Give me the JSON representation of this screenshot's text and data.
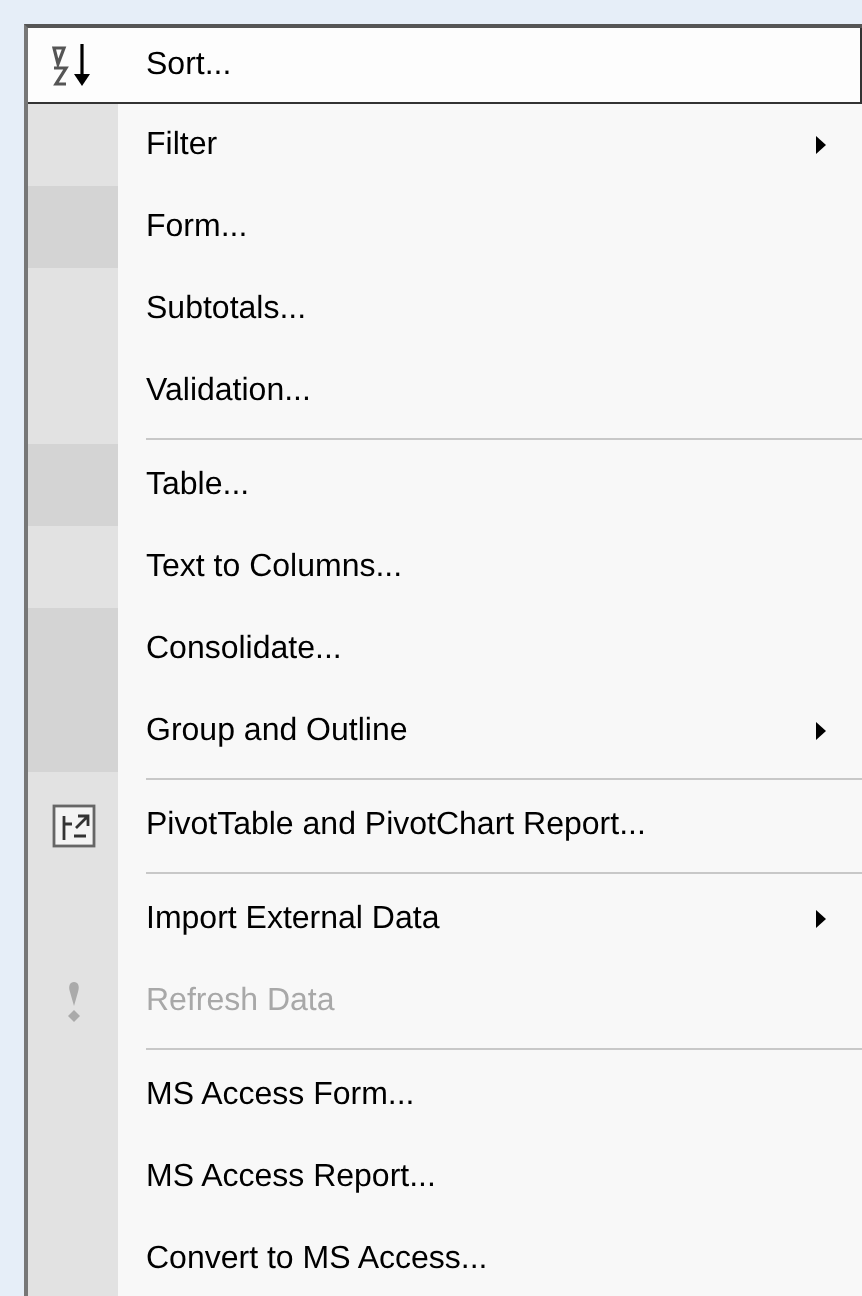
{
  "menu": {
    "items": [
      {
        "kind": "sort",
        "label": "Sort...",
        "selected": true,
        "submenu": false,
        "disabled": false,
        "recent": true
      },
      {
        "kind": "plain",
        "label": "Filter",
        "selected": false,
        "submenu": true,
        "disabled": false,
        "recent": true
      },
      {
        "kind": "plain",
        "label": "Form...",
        "selected": false,
        "submenu": false,
        "disabled": false,
        "recent": false
      },
      {
        "kind": "plain",
        "label": "Subtotals...",
        "selected": false,
        "submenu": false,
        "disabled": false,
        "recent": true
      },
      {
        "kind": "plain",
        "label": "Validation...",
        "selected": false,
        "submenu": false,
        "disabled": false,
        "recent": true
      },
      {
        "kind": "separator"
      },
      {
        "kind": "plain",
        "label": "Table...",
        "selected": false,
        "submenu": false,
        "disabled": false,
        "recent": false
      },
      {
        "kind": "plain",
        "label": "Text to Columns...",
        "selected": false,
        "submenu": false,
        "disabled": false,
        "recent": true
      },
      {
        "kind": "plain",
        "label": "Consolidate...",
        "selected": false,
        "submenu": false,
        "disabled": false,
        "recent": false
      },
      {
        "kind": "plain",
        "label": "Group and Outline",
        "selected": false,
        "submenu": true,
        "disabled": false,
        "recent": false
      },
      {
        "kind": "separator"
      },
      {
        "kind": "pivot",
        "label": "PivotTable and PivotChart Report...",
        "selected": false,
        "submenu": false,
        "disabled": false,
        "recent": true
      },
      {
        "kind": "separator"
      },
      {
        "kind": "plain",
        "label": "Import External Data",
        "selected": false,
        "submenu": true,
        "disabled": false,
        "recent": true
      },
      {
        "kind": "refresh",
        "label": "Refresh Data",
        "selected": false,
        "submenu": false,
        "disabled": true,
        "recent": true
      },
      {
        "kind": "separator"
      },
      {
        "kind": "plain",
        "label": "MS Access Form...",
        "selected": false,
        "submenu": false,
        "disabled": false,
        "recent": true
      },
      {
        "kind": "plain",
        "label": "MS Access Report...",
        "selected": false,
        "submenu": false,
        "disabled": false,
        "recent": true
      },
      {
        "kind": "plain",
        "label": "Convert to MS Access...",
        "selected": false,
        "submenu": false,
        "disabled": false,
        "recent": true
      }
    ]
  }
}
